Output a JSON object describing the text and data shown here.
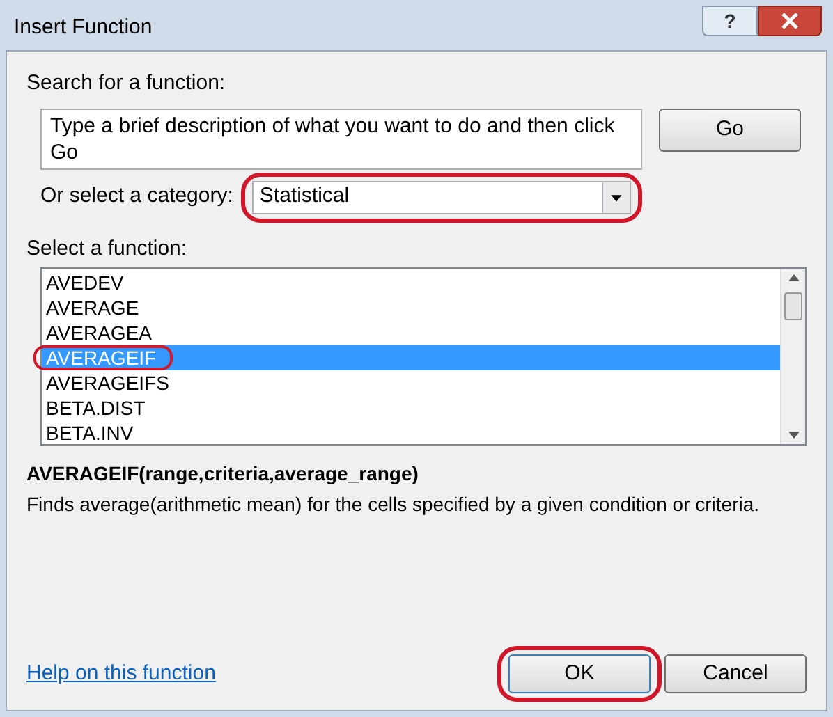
{
  "window": {
    "title": "Insert Function",
    "help_button": "?"
  },
  "search": {
    "label": "Search for a function:",
    "value": "Type a brief description of what you want to do and then click Go",
    "go_button": "Go"
  },
  "category": {
    "label": "Or select a category:",
    "value": "Statistical",
    "highlighted": true
  },
  "functions": {
    "label": "Select a function:",
    "items": [
      {
        "name": "AVEDEV",
        "selected": false,
        "highlighted": false
      },
      {
        "name": "AVERAGE",
        "selected": false,
        "highlighted": false
      },
      {
        "name": "AVERAGEA",
        "selected": false,
        "highlighted": false
      },
      {
        "name": "AVERAGEIF",
        "selected": true,
        "highlighted": true
      },
      {
        "name": "AVERAGEIFS",
        "selected": false,
        "highlighted": false
      },
      {
        "name": "BETA.DIST",
        "selected": false,
        "highlighted": false
      },
      {
        "name": "BETA.INV",
        "selected": false,
        "highlighted": false
      }
    ]
  },
  "syntax": "AVERAGEIF(range,criteria,average_range)",
  "description": "Finds average(arithmetic mean) for the cells specified by a given condition or criteria.",
  "help_link": "Help on this function",
  "buttons": [
    {
      "label": "OK",
      "highlighted": true
    },
    {
      "label": "Cancel",
      "highlighted": false
    }
  ]
}
